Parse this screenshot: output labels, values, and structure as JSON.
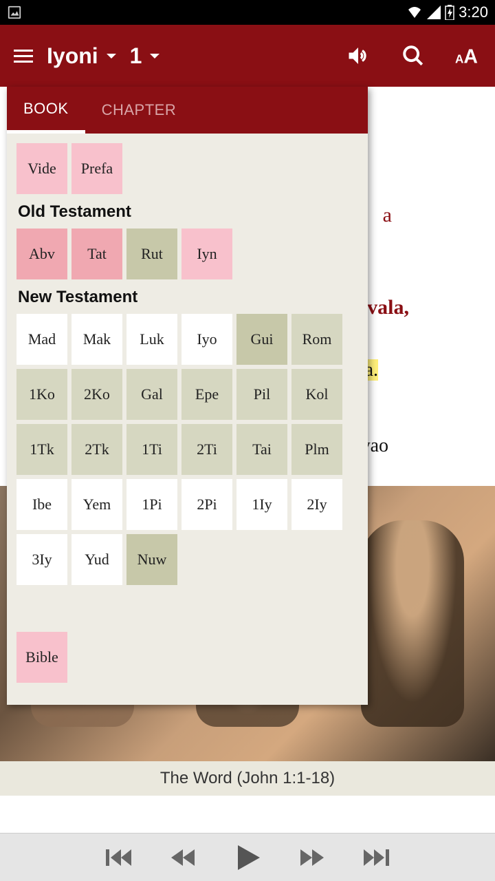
{
  "status": {
    "time": "3:20"
  },
  "appbar": {
    "book": "Iyoni",
    "chapter": "1"
  },
  "popup": {
    "tabs": {
      "book": "BOOK",
      "chapter": "CHAPTER"
    },
    "intro": [
      {
        "label": "Vide",
        "style": "pink"
      },
      {
        "label": "Prefa",
        "style": "pink"
      }
    ],
    "ot_label": "Old Testament",
    "ot": [
      {
        "label": "Abv",
        "style": "pinkdark"
      },
      {
        "label": "Tat",
        "style": "pinkdark"
      },
      {
        "label": "Rut",
        "style": "olive"
      },
      {
        "label": "Iyn",
        "style": "pink"
      }
    ],
    "nt_label": "New Testament",
    "nt": [
      {
        "label": "Mad",
        "style": "white"
      },
      {
        "label": "Mak",
        "style": "white"
      },
      {
        "label": "Luk",
        "style": "white"
      },
      {
        "label": "Iyo",
        "style": "white"
      },
      {
        "label": "Gui",
        "style": "olive"
      },
      {
        "label": "Rom",
        "style": "olivelight"
      },
      {
        "label": "1Ko",
        "style": "olivelight"
      },
      {
        "label": "2Ko",
        "style": "olivelight"
      },
      {
        "label": "Gal",
        "style": "olivelight"
      },
      {
        "label": "Epe",
        "style": "olivelight"
      },
      {
        "label": "Pil",
        "style": "olivelight"
      },
      {
        "label": "Kol",
        "style": "olivelight"
      },
      {
        "label": "1Tk",
        "style": "olivelight"
      },
      {
        "label": "2Tk",
        "style": "olivelight"
      },
      {
        "label": "1Ti",
        "style": "olivelight"
      },
      {
        "label": "2Ti",
        "style": "olivelight"
      },
      {
        "label": "Tai",
        "style": "olivelight"
      },
      {
        "label": "Plm",
        "style": "olivelight"
      },
      {
        "label": "Ibe",
        "style": "white"
      },
      {
        "label": "Yem",
        "style": "white"
      },
      {
        "label": "1Pi",
        "style": "white"
      },
      {
        "label": "2Pi",
        "style": "white"
      },
      {
        "label": "1Iy",
        "style": "white"
      },
      {
        "label": "2Iy",
        "style": "white"
      },
      {
        "label": "3Iy",
        "style": "white"
      },
      {
        "label": "Yud",
        "style": "white"
      },
      {
        "label": "Nuw",
        "style": "olive"
      }
    ],
    "bottom": [
      {
        "label": "Bible",
        "style": "pink"
      }
    ]
  },
  "content": {
    "heading_fragment": "a",
    "line_fragment1": "vala,",
    "line_fragment2": "a.",
    "line_fragment3": "vao"
  },
  "caption": "The Word (John 1:1-18)"
}
